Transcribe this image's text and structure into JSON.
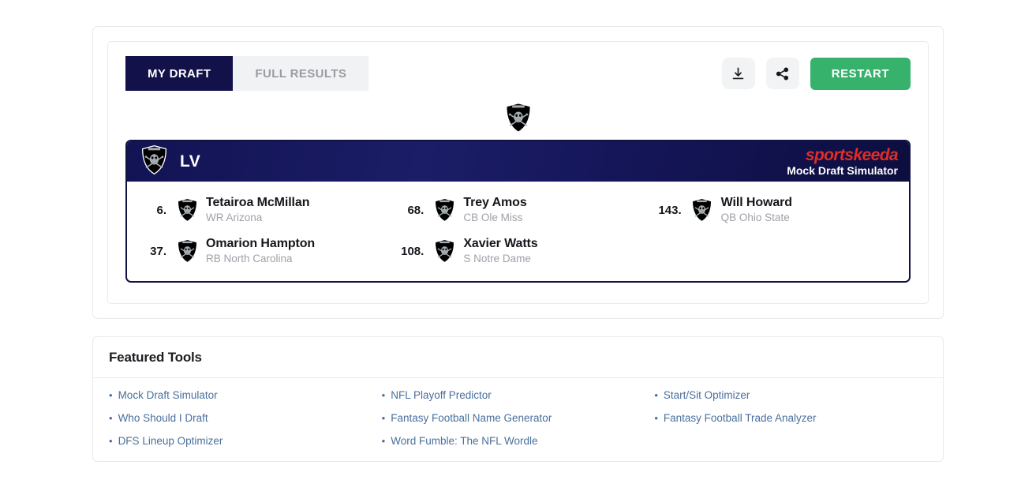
{
  "toolbar": {
    "tabs": [
      {
        "label": "MY DRAFT",
        "active": true
      },
      {
        "label": "FULL RESULTS",
        "active": false
      }
    ],
    "download_icon": "download-icon",
    "share_icon": "share-icon",
    "restart_label": "RESTART"
  },
  "draft": {
    "team_abbr": "LV",
    "team_logo": "raiders-shield-logo",
    "brand_word": "sportskeeda",
    "brand_sub": "Mock Draft Simulator",
    "columns": [
      [
        {
          "pick": "6.",
          "name": "Tetairoa McMillan",
          "meta": "WR Arizona"
        },
        {
          "pick": "37.",
          "name": "Omarion Hampton",
          "meta": "RB North Carolina"
        }
      ],
      [
        {
          "pick": "68.",
          "name": "Trey Amos",
          "meta": "CB Ole Miss"
        },
        {
          "pick": "108.",
          "name": "Xavier Watts",
          "meta": "S Notre Dame"
        }
      ],
      [
        {
          "pick": "143.",
          "name": "Will Howard",
          "meta": "QB Ohio State"
        }
      ]
    ]
  },
  "featured_tools": {
    "title": "Featured Tools",
    "links": [
      "Mock Draft Simulator",
      "NFL Playoff Predictor",
      "Start/Sit Optimizer",
      "Who Should I Draft",
      "Fantasy Football Name Generator",
      "Fantasy Football Trade Analyzer",
      "DFS Lineup Optimizer",
      "Word Fumble: The NFL Wordle"
    ],
    "bullet": "•"
  },
  "colors": {
    "tab_active_bg": "#12114a",
    "tab_inactive_bg": "#f1f2f4",
    "restart_green": "#37b26c",
    "banner_navy": "#151660",
    "brand_red": "#e02d28",
    "link_blue": "#4a6f9c"
  }
}
